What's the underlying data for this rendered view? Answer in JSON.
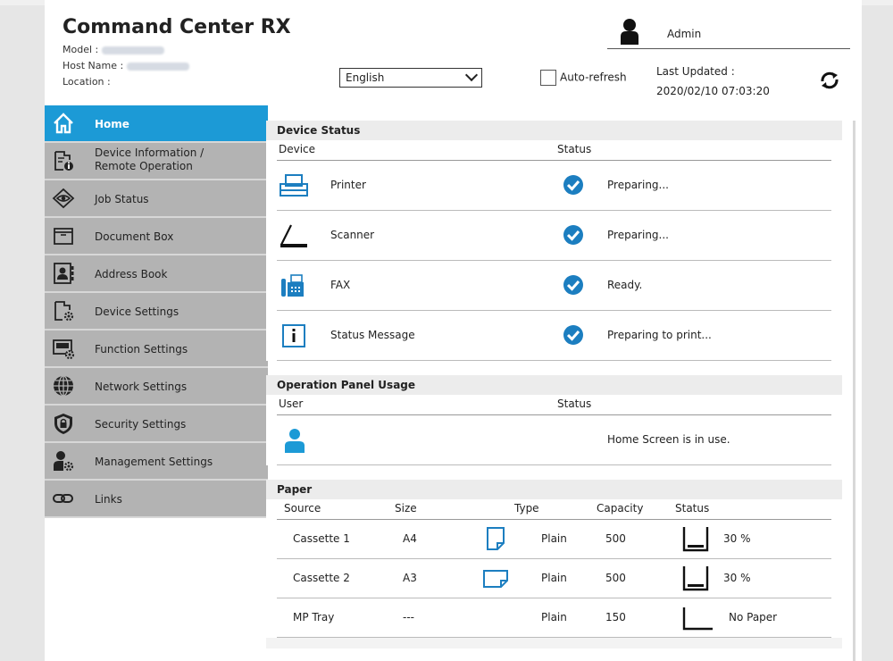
{
  "header": {
    "brand": "Command Center RX",
    "model_label": "Model :",
    "host_label": "Host Name :",
    "location_label": "Location :",
    "user_name": "Admin",
    "language": "English",
    "auto_refresh_label": "Auto-refresh",
    "last_updated_label": "Last Updated :",
    "last_updated_value": "2020/02/10 07:03:20"
  },
  "sidebar": {
    "items": [
      {
        "label": "Home",
        "icon": "home-icon",
        "active": true
      },
      {
        "label": "Device Information /",
        "label2": "Remote Operation",
        "icon": "device-info-icon"
      },
      {
        "label": "Job Status",
        "icon": "eye-icon"
      },
      {
        "label": "Document Box",
        "icon": "folder-icon"
      },
      {
        "label": "Address Book",
        "icon": "address-book-icon"
      },
      {
        "label": "Device Settings",
        "icon": "device-settings-icon"
      },
      {
        "label": "Function Settings",
        "icon": "function-settings-icon"
      },
      {
        "label": "Network Settings",
        "icon": "globe-icon"
      },
      {
        "label": "Security Settings",
        "icon": "shield-icon"
      },
      {
        "label": "Management Settings",
        "icon": "management-icon"
      },
      {
        "label": "Links",
        "icon": "link-icon"
      }
    ]
  },
  "device_status": {
    "title": "Device Status",
    "col_device": "Device",
    "col_status": "Status",
    "rows": [
      {
        "device": "Printer",
        "icon": "printer-icon",
        "status": "Preparing..."
      },
      {
        "device": "Scanner",
        "icon": "scanner-icon",
        "status": "Preparing..."
      },
      {
        "device": "FAX",
        "icon": "fax-icon",
        "status": "Ready."
      },
      {
        "device": "Status Message",
        "icon": "info-icon",
        "status": "Preparing to print..."
      }
    ]
  },
  "operation_panel": {
    "title": "Operation Panel Usage",
    "col_user": "User",
    "col_status": "Status",
    "status": "Home Screen is in use."
  },
  "paper": {
    "title": "Paper",
    "columns": [
      "Source",
      "Size",
      "Type",
      "Capacity",
      "Status"
    ],
    "rows": [
      {
        "source": "Cassette 1",
        "size": "A4",
        "type": "Plain",
        "capacity": "500",
        "status": "30 %",
        "level": 30
      },
      {
        "source": "Cassette 2",
        "size": "A3",
        "type": "Plain",
        "capacity": "500",
        "status": "30 %",
        "level": 30
      },
      {
        "source": "MP Tray",
        "size": "---",
        "type": "Plain",
        "capacity": "150",
        "status": "No Paper",
        "level": 0
      }
    ]
  },
  "colors": {
    "accent": "#1c9ad6",
    "sidebar": "#b3b3b3"
  }
}
